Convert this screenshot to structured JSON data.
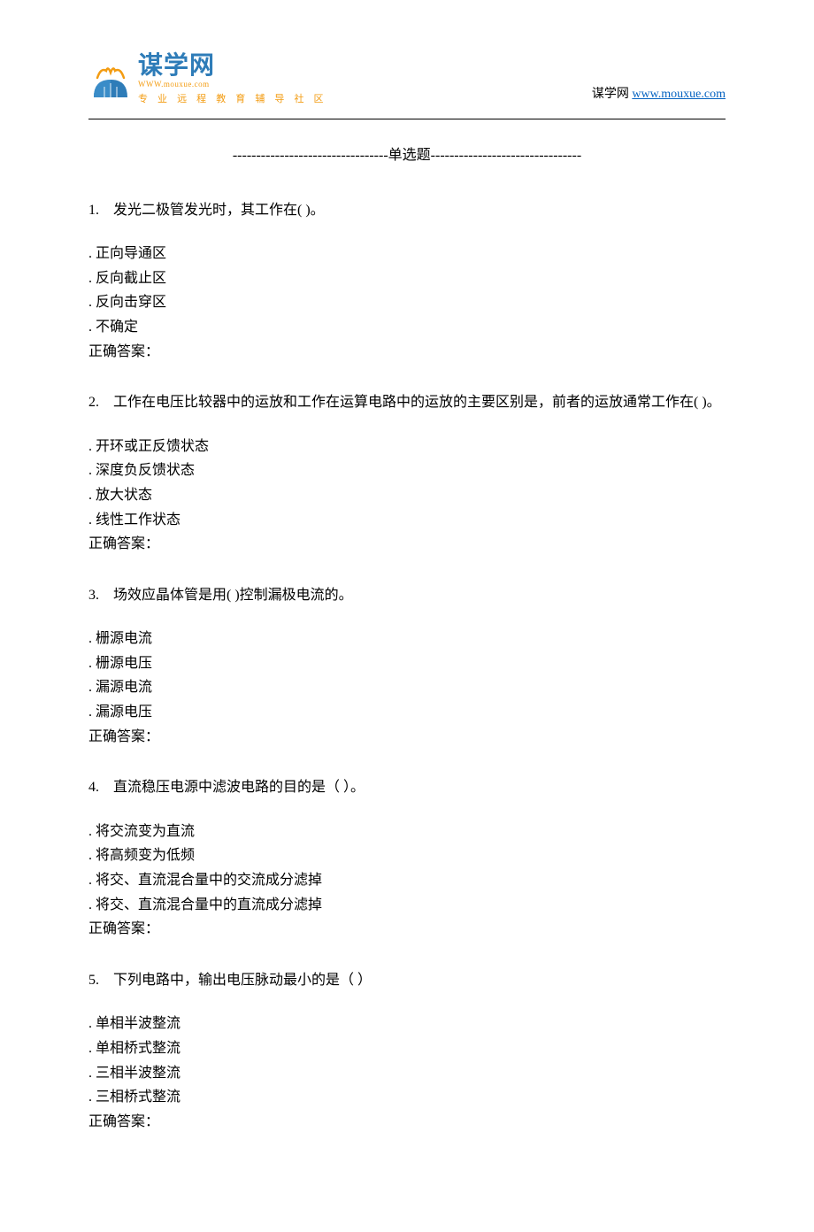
{
  "logo": {
    "cn": "谋学网",
    "url_small": "WWW.mouxue.com",
    "tagline": "专 业 远 程 教 育 辅 导 社 区"
  },
  "header_right": {
    "text": "谋学网 ",
    "link": "www.mouxue.com"
  },
  "section_header": "---------------------------------单选题--------------------------------",
  "questions": [
    {
      "num": "1.",
      "stem": "发光二极管发光时，其工作在(    )。",
      "options": [
        ". 正向导通区",
        ". 反向截止区",
        ". 反向击穿区",
        ". 不确定"
      ],
      "answer_label": "正确答案："
    },
    {
      "num": "2.",
      "stem": "工作在电压比较器中的运放和工作在运算电路中的运放的主要区别是，前者的运放通常工作在(    )。",
      "options": [
        ". 开环或正反馈状态",
        ". 深度负反馈状态",
        ". 放大状态",
        ". 线性工作状态"
      ],
      "answer_label": "正确答案："
    },
    {
      "num": "3.",
      "stem": "场效应晶体管是用(   )控制漏极电流的。",
      "options": [
        ". 栅源电流",
        ". 栅源电压",
        ". 漏源电流",
        ". 漏源电压"
      ],
      "answer_label": "正确答案："
    },
    {
      "num": "4.",
      "stem": "直流稳压电源中滤波电路的目的是（     ）。",
      "options": [
        ". 将交流变为直流",
        ". 将高频变为低频",
        ". 将交、直流混合量中的交流成分滤掉",
        ". 将交、直流混合量中的直流成分滤掉"
      ],
      "answer_label": "正确答案："
    },
    {
      "num": "5.",
      "stem": "下列电路中，输出电压脉动最小的是（       ）",
      "options": [
        ". 单相半波整流",
        ". 单相桥式整流",
        ". 三相半波整流",
        ". 三相桥式整流"
      ],
      "answer_label": "正确答案："
    }
  ]
}
